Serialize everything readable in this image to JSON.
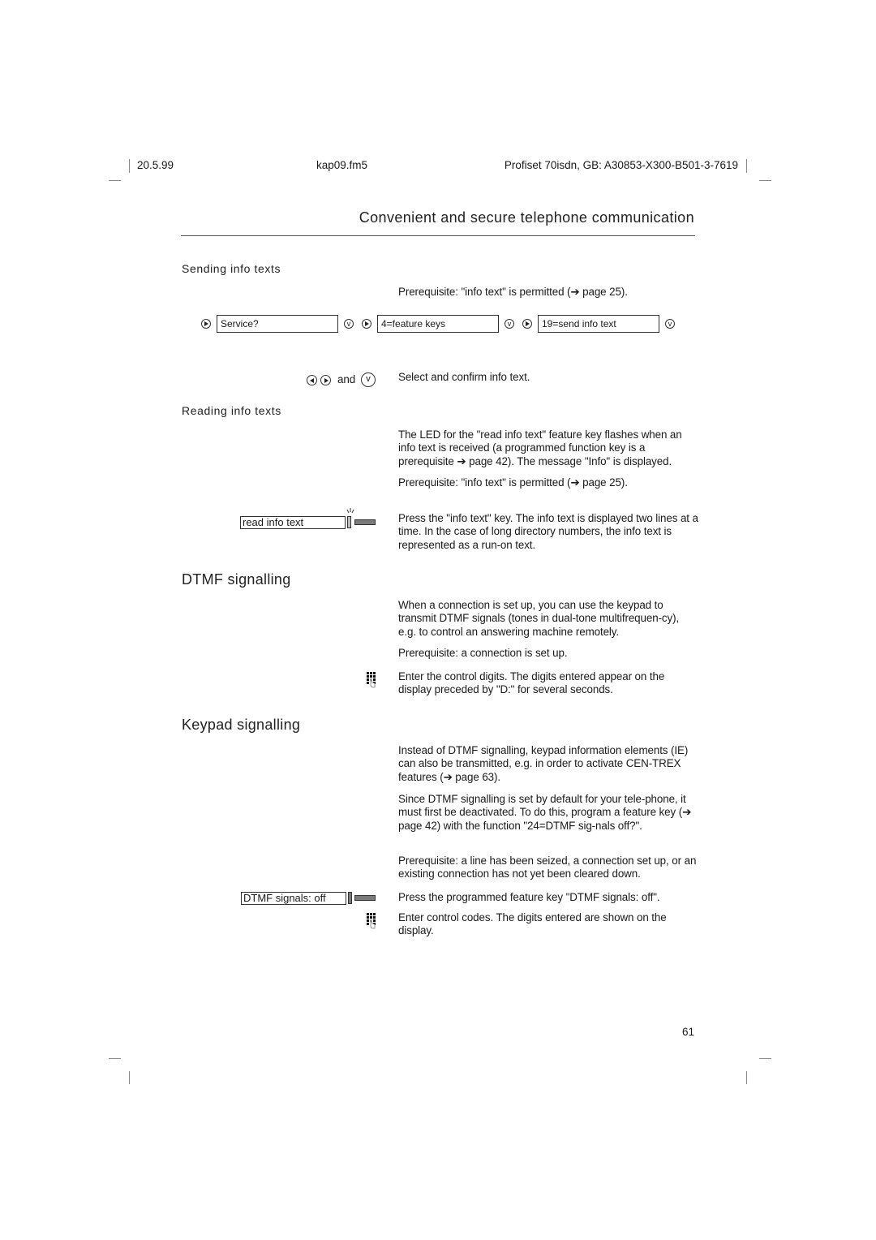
{
  "header": {
    "date": "20.5.99",
    "file": "kap09.fm5",
    "product": "Profiset 70isdn, GB: A30853-X300-B501-3-7619"
  },
  "chapter_title": "Convenient and secure telephone communication",
  "sending": {
    "heading": "Sending info texts",
    "prerequisite": "Prerequisite: \"info text\" is permitted (➔ page 25).",
    "steps": [
      {
        "display": "Service?",
        "nav_icon": "right-arrow-icon",
        "confirm_icon": "checkmark-icon"
      },
      {
        "display": "4=feature keys",
        "nav_icon": "right-arrow-icon",
        "confirm_icon": "checkmark-icon"
      },
      {
        "display": "19=send info text",
        "nav_icon": "right-arrow-icon",
        "confirm_icon": "checkmark-icon"
      }
    ],
    "select_and": "and",
    "select_text": "Select and confirm info text."
  },
  "reading": {
    "heading": "Reading info texts",
    "para1": "The LED for the \"read info text\" feature key flashes when an info text is received (a programmed function key is a prerequisite ➔ page 42). The message \"Info\" is displayed.",
    "prerequisite": "Prerequisite: \"info text\" is permitted (➔ page 25).",
    "key_label": "read info text",
    "key_text": "Press the \"info text\" key. The info text is displayed two lines at a time. In the case of long directory numbers, the info text is represented as a run-on text."
  },
  "dtmf": {
    "heading": "DTMF signalling",
    "para1": "When a connection is set up, you can use the keypad to transmit DTMF signals (tones in dual-tone multifrequen-cy), e.g. to control an answering machine remotely.",
    "prerequisite": "Prerequisite: a connection is set up.",
    "keypad_text": "Enter the control digits. The digits entered appear on the display preceded by \"D:\" for several seconds."
  },
  "keypad": {
    "heading": "Keypad signalling",
    "para1": "Instead of DTMF signalling, keypad information elements (IE) can also be transmitted, e.g. in order to activate CEN-TREX features (➔ page 63).",
    "para2": "Since DTMF signalling is set by default for your tele-phone, it must first be deactivated. To do this, program a feature key (➔ page 42) with the function \"24=DTMF sig-nals off?\".",
    "prerequisite": "Prerequisite: a line has been seized, a connection set up, or an existing connection has not yet been cleared down.",
    "key_label": "DTMF signals: off",
    "key_text": "Press the programmed feature key \"DTMF signals: off\".",
    "keypad_text": "Enter control codes. The digits entered are shown on the display."
  },
  "page_number": "61"
}
